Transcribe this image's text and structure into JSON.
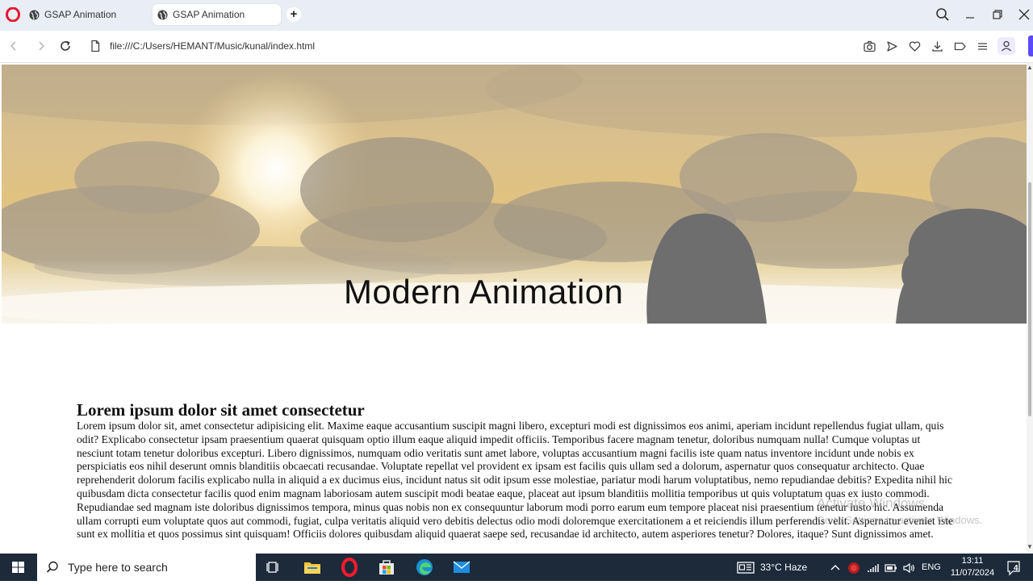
{
  "browser": {
    "tabs": [
      {
        "label": "GSAP Animation",
        "active": false
      },
      {
        "label": "GSAP Animation",
        "active": true
      }
    ],
    "new_tab_label": "+",
    "url": "file:///C:/Users/HEMANT/Music/kunal/index.html",
    "accent_color": "#5b4bff"
  },
  "page": {
    "hero_title": "Modern Animation",
    "heading": "Lorem ipsum dolor sit amet consectetur",
    "paragraph": "Lorem ipsum dolor sit, amet consectetur adipisicing elit. Maxime eaque accusantium suscipit magni libero, excepturi modi est dignissimos eos animi, aperiam incidunt repellendus fugiat ullam, quis odit? Explicabo consectetur ipsam praesentium quaerat quisquam optio illum eaque aliquid impedit officiis. Temporibus facere magnam tenetur, doloribus numquam nulla! Cumque voluptas ut nesciunt totam tenetur doloribus excepturi. Libero dignissimos, numquam odio veritatis sunt amet labore, voluptas accusantium magni facilis iste quam natus inventore incidunt unde nobis ex perspiciatis eos nihil deserunt omnis blanditiis obcaecati recusandae. Voluptate repellat vel provident ex ipsam est facilis quis ullam sed a dolorum, aspernatur quos consequatur architecto. Quae reprehenderit dolorum facilis explicabo nulla in aliquid a ex ducimus eius, incidunt natus sit odit ipsum esse molestiae, pariatur modi harum voluptatibus, nemo repudiandae debitis? Expedita nihil hic quibusdam dicta consectetur facilis quod enim magnam laboriosam autem suscipit modi beatae eaque, placeat aut ipsum blanditiis mollitia temporibus ut quis voluptatum quas ex iusto commodi. Repudiandae sed magnam iste doloribus dignissimos tempora, minus quas nobis non ex consequuntur laborum modi porro earum eum tempore placeat nisi praesentium tenetur iusto hic. Assumenda ullam corrupti eum voluptate quos aut commodi, fugiat, culpa veritatis aliquid vero debitis delectus odio modi doloremque exercitationem a et reiciendis illum perferendis velit. Aspernatur eveniet iste sunt ex mollitia et quos possimus sint quisquam! Officiis dolores quibusdam aliquid quaerat saepe sed, recusandae id architecto, autem asperiores tenetur? Dolores, itaque? Sunt dignissimos amet."
  },
  "watermark": {
    "title": "Activate Windows",
    "subtitle": "Go to Settings to activate Windows."
  },
  "taskbar": {
    "search_placeholder": "Type here to search",
    "weather": "33°C  Haze",
    "language": "ENG",
    "time": "13:11",
    "date": "11/07/2024",
    "notification_count": "4"
  }
}
